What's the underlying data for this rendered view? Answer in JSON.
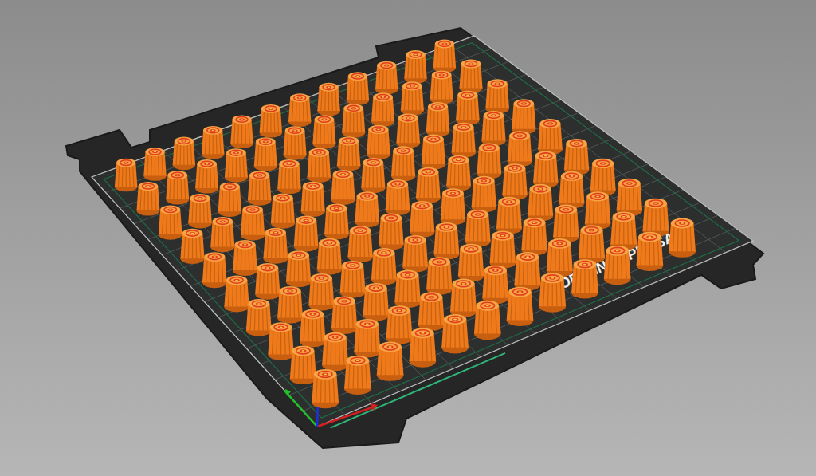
{
  "viewport": {
    "bed_label": "ORIGINAL PRUSA M"
  }
}
